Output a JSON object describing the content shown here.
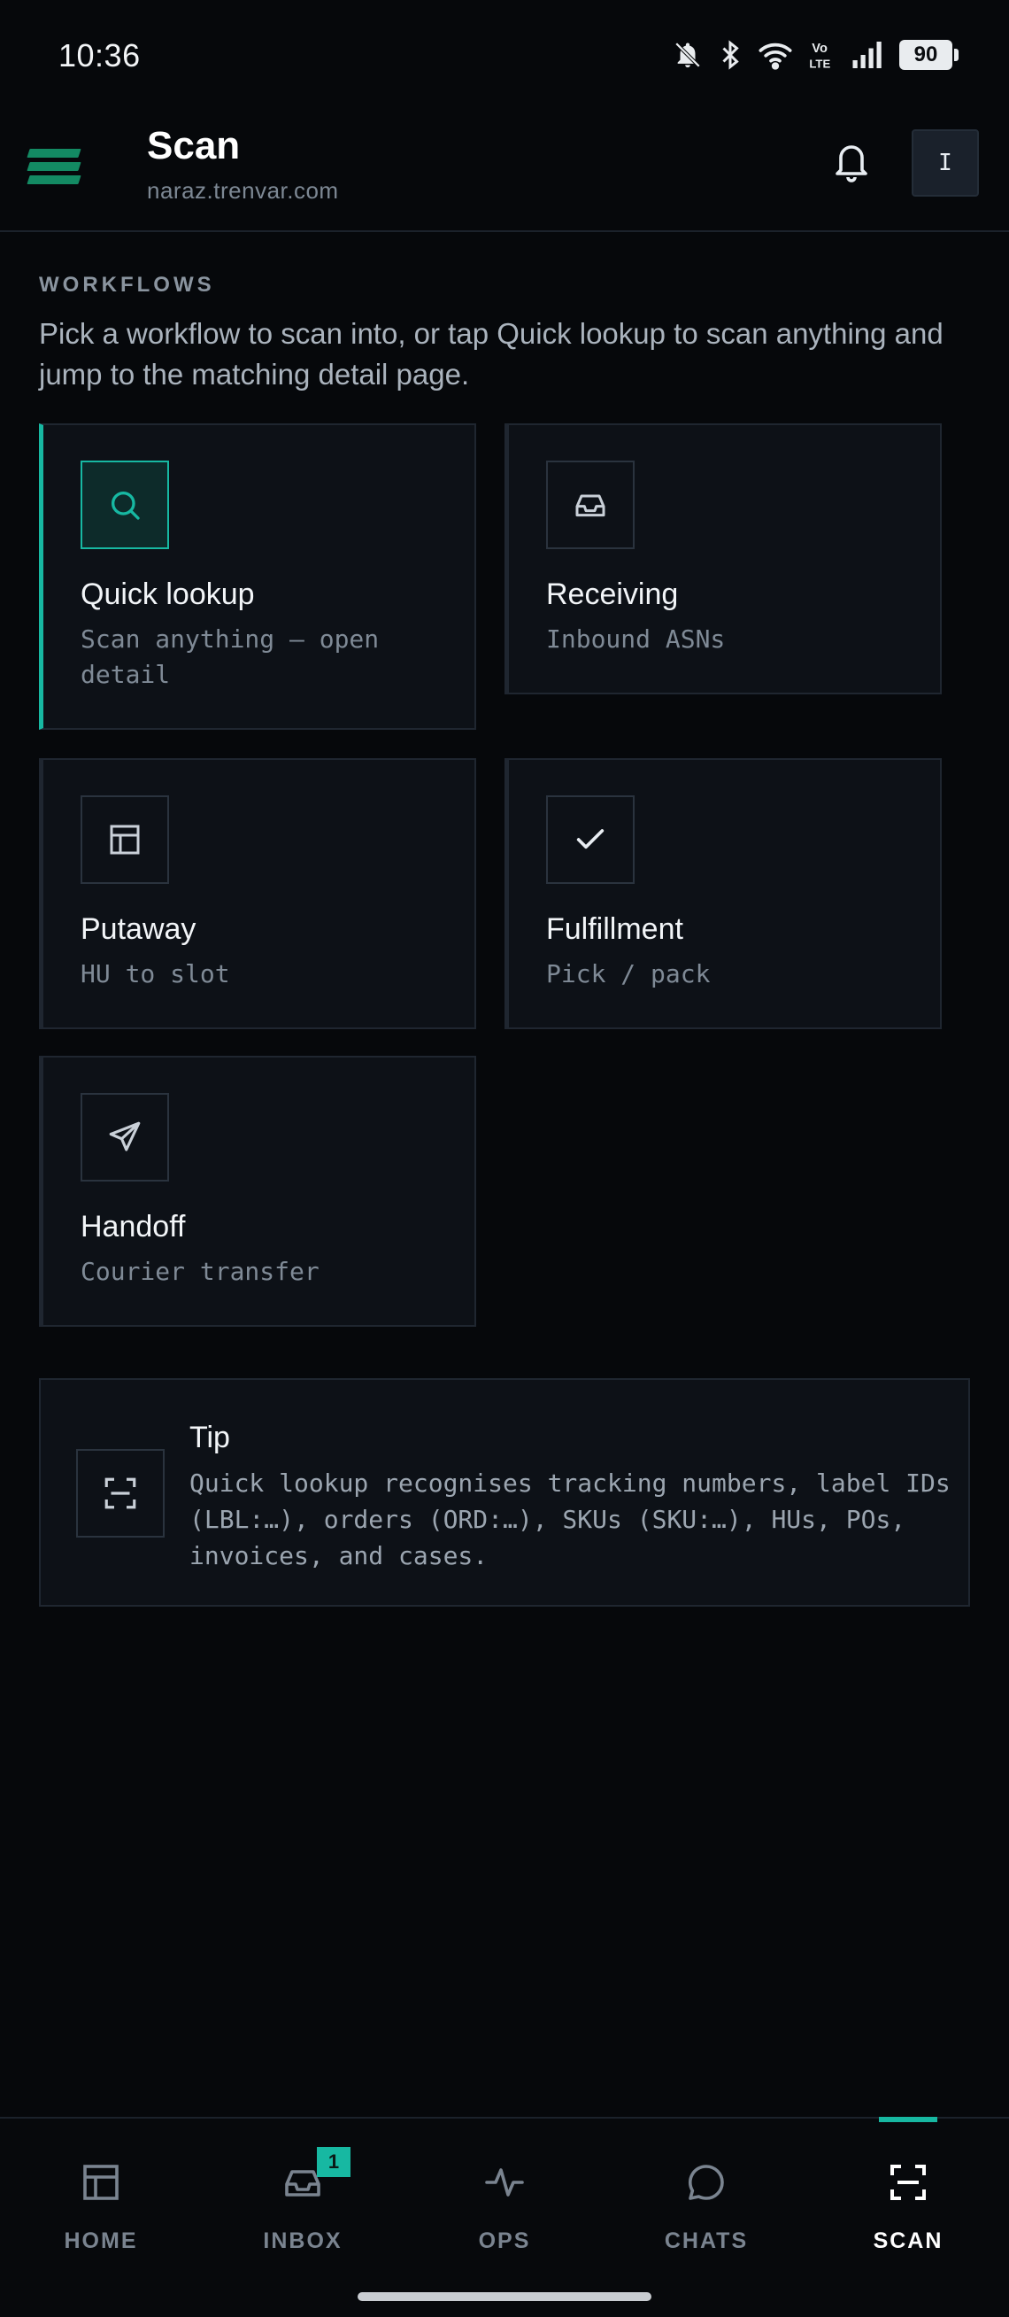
{
  "status_bar": {
    "time": "10:36",
    "battery": "90",
    "icons": [
      "bell-off-icon",
      "bluetooth-icon",
      "wifi-icon",
      "volte-icon",
      "signal-icon",
      "battery-icon"
    ]
  },
  "header": {
    "title": "Scan",
    "subtitle": "naraz.trenvar.com",
    "avatar_initial": "I"
  },
  "section": {
    "label": "WORKFLOWS",
    "description": "Pick a workflow to scan into, or tap Quick lookup to scan anything and jump to the matching detail page."
  },
  "workflows": [
    {
      "title": "Quick lookup",
      "subtitle": "Scan anything — open detail",
      "icon": "search-icon",
      "active": true
    },
    {
      "title": "Receiving",
      "subtitle": "Inbound ASNs",
      "icon": "inbox-tray-icon",
      "active": false
    },
    {
      "title": "Putaway",
      "subtitle": "HU to slot",
      "icon": "grid-layout-icon",
      "active": false
    },
    {
      "title": "Fulfillment",
      "subtitle": "Pick / pack",
      "icon": "check-icon",
      "active": false
    },
    {
      "title": "Handoff",
      "subtitle": "Courier transfer",
      "icon": "send-icon",
      "active": false
    }
  ],
  "tip": {
    "title": "Tip",
    "text": "Quick lookup recognises tracking numbers, label IDs (LBL:…), orders (ORD:…), SKUs (SKU:…), HUs, POs, invoices, and cases."
  },
  "bottom_nav": [
    {
      "label": "HOME",
      "icon": "home-grid-icon",
      "active": false
    },
    {
      "label": "INBOX",
      "icon": "inbox-icon",
      "active": false,
      "badge": "1"
    },
    {
      "label": "OPS",
      "icon": "activity-icon",
      "active": false
    },
    {
      "label": "CHATS",
      "icon": "chat-bubble-icon",
      "active": false
    },
    {
      "label": "SCAN",
      "icon": "scan-icon",
      "active": true
    }
  ],
  "colors": {
    "background": "#06080b",
    "card": "#0d1117",
    "accent": "#17b8a2",
    "logo": "#138a63"
  }
}
